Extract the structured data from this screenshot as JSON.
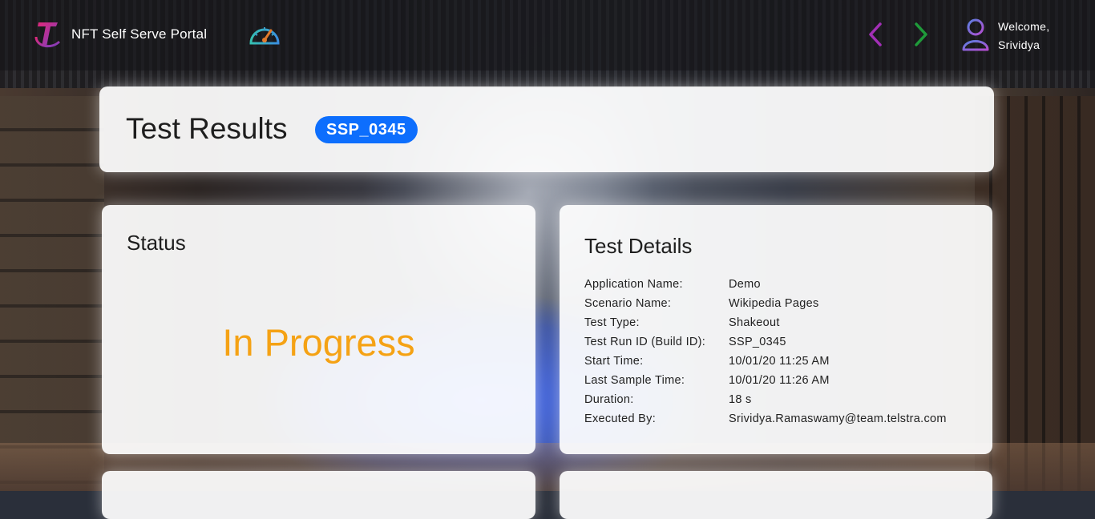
{
  "header": {
    "app_title": "NFT Self Serve Portal",
    "welcome_line1": "Welcome,",
    "welcome_line2": "Srividya"
  },
  "page": {
    "title": "Test Results",
    "run_badge": "SSP_0345"
  },
  "status_card": {
    "heading": "Status",
    "value": "In Progress"
  },
  "details_card": {
    "heading": "Test Details",
    "rows": [
      {
        "label": "Application Name:",
        "value": "Demo"
      },
      {
        "label": "Scenario Name:",
        "value": "Wikipedia Pages"
      },
      {
        "label": "Test Type:",
        "value": "Shakeout"
      },
      {
        "label": "Test Run ID (Build ID):",
        "value": "SSP_0345"
      },
      {
        "label": "Start Time:",
        "value": "10/01/20 11:25 AM"
      },
      {
        "label": "Last Sample Time:",
        "value": "10/01/20 11:26 AM"
      },
      {
        "label": "Duration:",
        "value": "18 s"
      },
      {
        "label": "Executed By:",
        "value": "Srividya.Ramaswamy@team.telstra.com"
      }
    ]
  },
  "icons": {
    "logo": "telstra-logo-icon",
    "dashboard": "speedometer-icon",
    "back": "chevron-left-icon",
    "forward": "chevron-right-icon",
    "user": "user-icon"
  },
  "colors": {
    "status_in_progress": "#f5a214",
    "badge": "#0d6efd",
    "nav_back": "#a22fb6",
    "nav_forward": "#1f9a3a"
  }
}
